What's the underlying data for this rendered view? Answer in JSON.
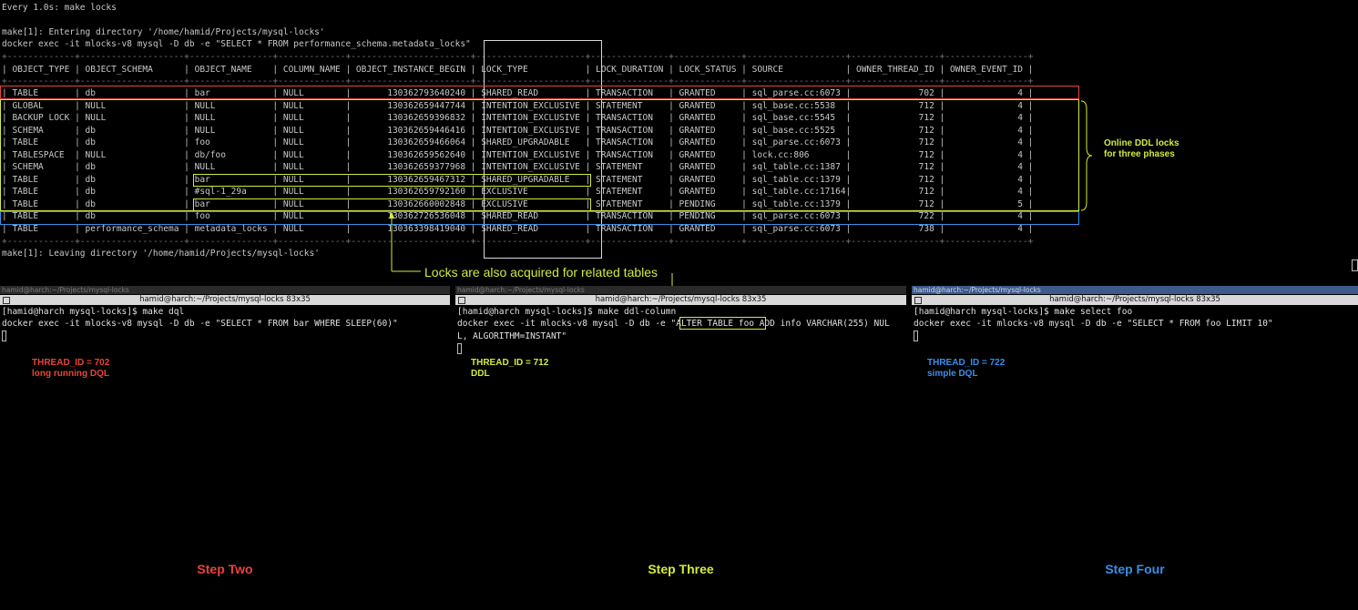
{
  "top": {
    "watch": "Every 1.0s: make locks",
    "enter": "make[1]: Entering directory '/home/hamid/Projects/mysql-locks'",
    "cmd": "docker exec -it mlocks-v8 mysql -D db -e \"SELECT * FROM performance_schema.metadata_locks\"",
    "sep": "+-------------+--------------------+----------------+-------------+-----------------------+---------------------+---------------+-------------+-------------------+-----------------+----------------+",
    "header": "| OBJECT_TYPE | OBJECT_SCHEMA      | OBJECT_NAME    | COLUMN_NAME | OBJECT_INSTANCE_BEGIN | LOCK_TYPE           | LOCK_DURATION | LOCK_STATUS | SOURCE            | OWNER_THREAD_ID | OWNER_EVENT_ID |",
    "rows": [
      "| TABLE       | db                 | bar            | NULL        |       130362793640240 | SHARED_READ         | TRANSACTION   | GRANTED     | sql_parse.cc:6073 |             702 |              4 |",
      "| GLOBAL      | NULL               | NULL           | NULL        |       130362659447744 | INTENTION_EXCLUSIVE | STATEMENT     | GRANTED     | sql_base.cc:5538  |             712 |              4 |",
      "| BACKUP LOCK | NULL               | NULL           | NULL        |       130362659396832 | INTENTION_EXCLUSIVE | TRANSACTION   | GRANTED     | sql_base.cc:5545  |             712 |              4 |",
      "| SCHEMA      | db                 | NULL           | NULL        |       130362659446416 | INTENTION_EXCLUSIVE | TRANSACTION   | GRANTED     | sql_base.cc:5525  |             712 |              4 |",
      "| TABLE       | db                 | foo            | NULL        |       130362659466064 | SHARED_UPGRADABLE   | TRANSACTION   | GRANTED     | sql_parse.cc:6073 |             712 |              4 |",
      "| TABLESPACE  | NULL               | db/foo         | NULL        |       130362659562640 | INTENTION_EXCLUSIVE | TRANSACTION   | GRANTED     | lock.cc:806       |             712 |              4 |",
      "| SCHEMA      | db                 | NULL           | NULL        |       130362659377968 | INTENTION_EXCLUSIVE | STATEMENT     | GRANTED     | sql_table.cc:1387 |             712 |              4 |",
      "| TABLE       | db                 | bar            | NULL        |       130362659467312 | SHARED_UPGRADABLE   | STATEMENT     | GRANTED     | sql_table.cc:1379 |             712 |              4 |",
      "| TABLE       | db                 | #sql-1_29a     | NULL        |       130362659792160 | EXCLUSIVE           | STATEMENT     | GRANTED     | sql_table.cc:17164|             712 |              4 |",
      "| TABLE       | db                 | bar            | NULL        |       130362660002848 | EXCLUSIVE           | STATEMENT     | PENDING     | sql_table.cc:1379 |             712 |              5 |",
      "| TABLE       | db                 | foo            | NULL        |       130362726536048 | SHARED_READ         | TRANSACTION   | PENDING     | sql_parse.cc:6073 |             722 |              4 |",
      "| TABLE       | performance_schema | metadata_locks | NULL        |       130363398419040 | SHARED_READ         | TRANSACTION   | GRANTED     | sql_parse.cc:6073 |             738 |              4 |"
    ],
    "leave": "make[1]: Leaving directory '/home/hamid/Projects/mysql-locks'"
  },
  "annotations": {
    "online_ddl": "Online DDL locks\nfor three phases",
    "related": "Locks are also acquired for related tables"
  },
  "terminals": [
    {
      "tab": "hamid@harch:~/Projects/mysql-locks",
      "title": "hamid@harch:~/Projects/mysql-locks 83x35",
      "prompt": "[hamid@harch mysql-locks]$ make dql",
      "cmd": "docker exec -it mlocks-v8 mysql -D db -e \"SELECT * FROM bar WHERE SLEEP(60)\"",
      "cmd2": "",
      "thread": "THREAD_ID = 702",
      "desc": "long running DQL",
      "step": "Step Two",
      "color": "#e8443a"
    },
    {
      "tab": "hamid@harch:~/Projects/mysql-locks",
      "title": "hamid@harch:~/Projects/mysql-locks 83x35",
      "prompt": "[hamid@harch mysql-locks]$ make ddl-column",
      "cmd": "docker exec -it mlocks-v8 mysql -D db -e \"ALTER TABLE foo ADD info VARCHAR(255) NUL",
      "cmd2": "L, ALGORITHM=INSTANT\"",
      "thread": "THREAD_ID = 712",
      "desc": "DDL",
      "step": "Step Three",
      "color": "#d4ea3c"
    },
    {
      "tab": "hamid@harch:~/Projects/mysql-locks",
      "title": "hamid@harch:~/Projects/mysql-locks 83x35",
      "prompt": "[hamid@harch mysql-locks]$ make select foo",
      "cmd": "docker exec -it mlocks-v8 mysql -D db -e \"SELECT * FROM foo LIMIT 10\"",
      "cmd2": "",
      "thread": "THREAD_ID = 722",
      "desc": "simple DQL",
      "step": "Step Four",
      "color": "#3a8ee8"
    }
  ],
  "colors": {
    "red": "#e8443a",
    "yellow": "#d4ea3c",
    "blue": "#3a8ee8",
    "white": "#d8d8d8"
  }
}
